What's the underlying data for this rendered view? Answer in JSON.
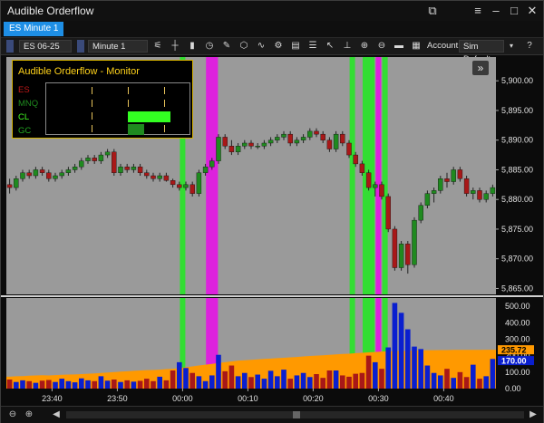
{
  "window": {
    "title": "Audible Orderflow"
  },
  "window_controls": [
    "capture",
    "menu",
    "minimize",
    "maximize",
    "close"
  ],
  "tab": {
    "label": "ES Minute 1"
  },
  "toolbar": {
    "instrument": "ES 06-25",
    "interval": "Minute 1",
    "account_label": "Account:",
    "account_value": "Sim Default",
    "help": "?",
    "icons": [
      "bar-chart-icon",
      "crosshair-icon",
      "chart-style-icon",
      "clock-icon",
      "draw-tool-icon",
      "shapes-icon",
      "indicators-icon",
      "strategies-icon",
      "templates-icon",
      "zoom-in-icon",
      "zoom-out-icon",
      "properties-icon",
      "print-icon",
      "fullscreen-icon"
    ]
  },
  "monitor": {
    "title": "Audible Orderflow - Monitor",
    "symbols": [
      {
        "name": "ES",
        "color": "#c01818",
        "bar_fraction": 0
      },
      {
        "name": "MNQ",
        "color": "#1f8a1f",
        "bar_fraction": 0
      },
      {
        "name": "CL",
        "color": "#44ff22",
        "bar_fraction": 0.59
      },
      {
        "name": "GC",
        "color": "#22a822",
        "bar_fraction": 0.22
      }
    ]
  },
  "price_labels": [
    "5,900.00",
    "5,895.00",
    "5,890.00",
    "5,885.00",
    "5,880.00",
    "5,875.00",
    "5,870.00",
    "5,865.00"
  ],
  "volume_labels": [
    "500.00",
    "400.00",
    "300.00",
    "200.00",
    "100.00",
    "0.00"
  ],
  "volume_badges": {
    "ma": "235.72",
    "current": "170.00"
  },
  "time_labels": [
    "23:40",
    "23:50",
    "00:00",
    "00:10",
    "00:20",
    "00:30",
    "00:40"
  ],
  "colors": {
    "up": "#1f8a1f",
    "down": "#a81818",
    "volume": "#0a1fcf",
    "volume_ma": "#ff9900",
    "green_band": "#33dd33",
    "magenta_band": "#dd22dd",
    "accent": "#1e8fe6"
  },
  "chart_data": {
    "type": "candlestick",
    "price_range": [
      5864,
      5904
    ],
    "volume_range": [
      0,
      550
    ],
    "time_range": [
      "23:33",
      "00:48"
    ],
    "highlights": [
      {
        "start": "00:00",
        "end": "00:00",
        "color": "green"
      },
      {
        "start": "00:04",
        "end": "00:05",
        "color": "magenta"
      },
      {
        "start": "00:26",
        "end": "00:26",
        "color": "green"
      },
      {
        "start": "00:28",
        "end": "00:29",
        "color": "green"
      },
      {
        "start": "00:30",
        "end": "00:30",
        "color": "magenta"
      },
      {
        "start": "00:31",
        "end": "00:31",
        "color": "green"
      }
    ],
    "candles": [
      [
        5882.5,
        5883.5,
        5881,
        5882
      ],
      [
        5882,
        5884,
        5881.5,
        5883.5
      ],
      [
        5883.5,
        5885,
        5883,
        5884.5
      ],
      [
        5884.5,
        5885,
        5883.5,
        5884
      ],
      [
        5884,
        5885.5,
        5883.5,
        5885
      ],
      [
        5885,
        5885.5,
        5884,
        5884.5
      ],
      [
        5884.5,
        5885,
        5883,
        5883.5
      ],
      [
        5883.5,
        5884.5,
        5883,
        5884
      ],
      [
        5884,
        5885,
        5883.5,
        5884.5
      ],
      [
        5884.5,
        5885.5,
        5884,
        5885
      ],
      [
        5885,
        5886,
        5884.5,
        5885.5
      ],
      [
        5885.5,
        5887,
        5885,
        5886.5
      ],
      [
        5886.5,
        5887.5,
        5886,
        5887
      ],
      [
        5887,
        5887.5,
        5886,
        5886.5
      ],
      [
        5886.5,
        5888,
        5886,
        5887.5
      ],
      [
        5887.5,
        5888.5,
        5887,
        5888
      ],
      [
        5888,
        5888.5,
        5884,
        5884.5
      ],
      [
        5884.5,
        5886,
        5884,
        5885.5
      ],
      [
        5885.5,
        5886,
        5884.5,
        5885
      ],
      [
        5885,
        5886,
        5884.5,
        5885.5
      ],
      [
        5885.5,
        5886,
        5884,
        5884.5
      ],
      [
        5884.5,
        5885,
        5883.5,
        5884
      ],
      [
        5884,
        5884.5,
        5883,
        5883.5
      ],
      [
        5883.5,
        5884.5,
        5883,
        5884
      ],
      [
        5884,
        5884.5,
        5883,
        5883.2
      ],
      [
        5883.2,
        5883.5,
        5882,
        5882.5
      ],
      [
        5882.5,
        5883,
        5881.5,
        5882
      ],
      [
        5882,
        5883,
        5881.5,
        5882.5
      ],
      [
        5882.5,
        5883,
        5880.5,
        5881
      ],
      [
        5881,
        5885,
        5880.5,
        5884.5
      ],
      [
        5884.5,
        5886,
        5884,
        5885.5
      ],
      [
        5885.5,
        5887,
        5885,
        5886.5
      ],
      [
        5886.5,
        5891,
        5886,
        5890.5
      ],
      [
        5890.5,
        5891,
        5888.5,
        5889
      ],
      [
        5889,
        5890,
        5887.5,
        5888
      ],
      [
        5888,
        5889.5,
        5887.5,
        5889
      ],
      [
        5889,
        5890,
        5888.5,
        5889.5
      ],
      [
        5889.5,
        5890,
        5888.5,
        5889
      ],
      [
        5889,
        5889.5,
        5888.5,
        5889
      ],
      [
        5889,
        5890,
        5888.5,
        5889.5
      ],
      [
        5889.5,
        5890.5,
        5889,
        5890
      ],
      [
        5890,
        5891,
        5889.5,
        5890.5
      ],
      [
        5890.5,
        5891.5,
        5890,
        5891
      ],
      [
        5891,
        5891.5,
        5889,
        5889.5
      ],
      [
        5889.5,
        5890.5,
        5889,
        5890
      ],
      [
        5890,
        5891,
        5889.5,
        5890.5
      ],
      [
        5890.5,
        5892,
        5890,
        5891.5
      ],
      [
        5891.5,
        5892,
        5890.5,
        5891
      ],
      [
        5891,
        5891.5,
        5889.5,
        5890
      ],
      [
        5890,
        5890.5,
        5888,
        5888.5
      ],
      [
        5888.5,
        5891.5,
        5888,
        5891
      ],
      [
        5891,
        5891.5,
        5889,
        5889.5
      ],
      [
        5889.5,
        5890,
        5887,
        5887.5
      ],
      [
        5887.5,
        5888,
        5885.5,
        5886
      ],
      [
        5886,
        5886.5,
        5884,
        5884.5
      ],
      [
        5884.5,
        5885,
        5881.5,
        5882
      ],
      [
        5882,
        5883,
        5880.5,
        5882.5
      ],
      [
        5882.5,
        5883,
        5880,
        5880.5
      ],
      [
        5880.5,
        5881,
        5874.5,
        5875
      ],
      [
        5875,
        5875.5,
        5868,
        5868.5
      ],
      [
        5868.5,
        5873,
        5868,
        5872.5
      ],
      [
        5872.5,
        5873,
        5867.5,
        5869
      ],
      [
        5869,
        5877,
        5868.5,
        5876.5
      ],
      [
        5876.5,
        5879.5,
        5876,
        5879
      ],
      [
        5879,
        5881.5,
        5878.5,
        5881
      ],
      [
        5881,
        5882,
        5879.5,
        5881.5
      ],
      [
        5881.5,
        5884,
        5881,
        5883.5
      ],
      [
        5883.5,
        5884.5,
        5882,
        5883
      ],
      [
        5883,
        5885.5,
        5882.5,
        5885
      ],
      [
        5885,
        5885.5,
        5883,
        5883.5
      ],
      [
        5883.5,
        5884,
        5880.5,
        5881
      ],
      [
        5881,
        5882,
        5880,
        5881.5
      ],
      [
        5881.5,
        5882,
        5879.5,
        5880
      ],
      [
        5880,
        5881.5,
        5879.5,
        5881
      ],
      [
        5881,
        5882.5,
        5880.5,
        5882
      ]
    ],
    "volumes": [
      55,
      40,
      50,
      45,
      35,
      48,
      52,
      40,
      60,
      45,
      38,
      62,
      50,
      45,
      75,
      48,
      55,
      40,
      50,
      42,
      47,
      60,
      45,
      72,
      50,
      110,
      160,
      125,
      95,
      75,
      45,
      80,
      205,
      105,
      140,
      75,
      95,
      70,
      85,
      60,
      108,
      75,
      115,
      60,
      80,
      95,
      70,
      88,
      65,
      110,
      110,
      80,
      72,
      90,
      95,
      200,
      160,
      120,
      250,
      520,
      460,
      360,
      255,
      240,
      140,
      95,
      80,
      120,
      65,
      100,
      70,
      145,
      60,
      75,
      180
    ],
    "volume_ma": [
      72,
      75,
      76,
      78,
      80,
      81,
      80,
      82,
      84,
      85,
      86,
      88,
      90,
      92,
      95,
      98,
      100,
      103,
      105,
      108,
      110,
      112,
      113,
      115,
      118,
      120,
      125,
      130,
      135,
      140,
      145,
      150,
      155,
      160,
      165,
      170,
      172,
      175,
      177,
      180,
      182,
      185,
      187,
      190,
      192,
      195,
      198,
      200,
      202,
      205,
      208,
      210,
      212,
      215,
      217,
      220,
      222,
      225,
      227,
      228,
      229,
      230,
      231,
      232,
      233,
      233,
      234,
      234,
      235,
      235,
      235,
      235.5,
      235.5,
      235.7,
      235.72
    ]
  }
}
